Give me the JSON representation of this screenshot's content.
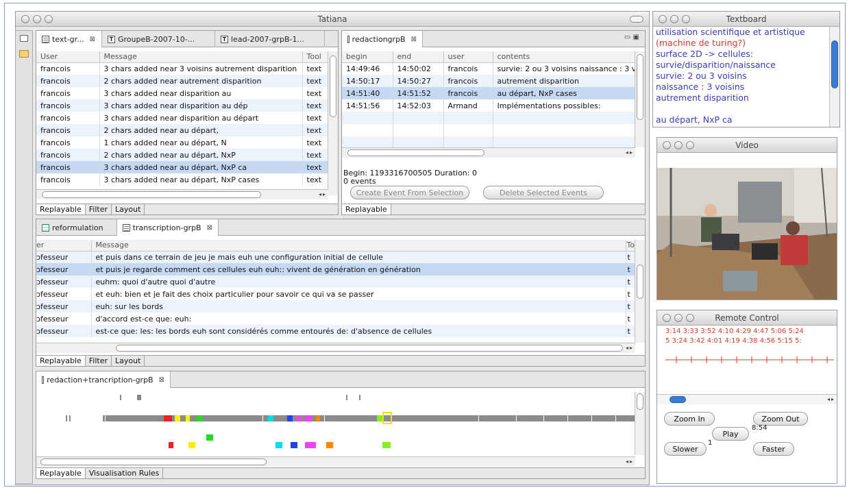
{
  "main_window": {
    "title": "Tatiana"
  },
  "text_panel": {
    "tabs": [
      {
        "label": "text-gr...",
        "closable": true
      },
      {
        "label": "GroupeB-2007-10-..."
      },
      {
        "label": "lead-2007-grpB-1..."
      }
    ],
    "columns": [
      "User",
      "Message",
      "Tool"
    ],
    "rows": [
      {
        "user": "francois",
        "message": "3 chars added near  3 voisins autrement disparition",
        "tool": "text"
      },
      {
        "user": "francois",
        "message": "2 chars added near  autrement disparition",
        "tool": "text"
      },
      {
        "user": "francois",
        "message": "3 chars added near  disparition  au",
        "tool": "text"
      },
      {
        "user": "francois",
        "message": "3 chars added near  disparition  au dép",
        "tool": "text"
      },
      {
        "user": "francois",
        "message": "3 chars added near  disparition  au départ",
        "tool": "text"
      },
      {
        "user": "francois",
        "message": "2 chars added near   au départ,",
        "tool": "text"
      },
      {
        "user": "francois",
        "message": "1 chars added near   au départ, N",
        "tool": "text"
      },
      {
        "user": "francois",
        "message": "2 chars added near   au départ, NxP",
        "tool": "text"
      },
      {
        "user": "francois",
        "message": "3 chars added near  au départ, NxP ca",
        "tool": "text"
      },
      {
        "user": "francois",
        "message": "3 chars added near  au départ, NxP cases",
        "tool": "text"
      }
    ],
    "bottom_tabs": [
      "Replayable",
      "Filter",
      "Layout"
    ]
  },
  "redaction_panel": {
    "tab": "redactiongrpB",
    "columns": [
      "begin",
      "end",
      "user",
      "contents"
    ],
    "rows": [
      {
        "begin": "14:49:46",
        "end": "14:50:02",
        "user": "francois",
        "contents": "survie: 2 ou 3 voisins naissance : 3 vo"
      },
      {
        "begin": "14:50:17",
        "end": "14:50:27",
        "user": "francois",
        "contents": "autrement disparition"
      },
      {
        "begin": "14:51:40",
        "end": "14:51:52",
        "user": "francois",
        "contents": "au départ, NxP cases"
      },
      {
        "begin": "14:51:56",
        "end": "14:52:03",
        "user": "Armand",
        "contents": "Implémentations possibles:"
      }
    ],
    "info_begin": "Begin: 1193316700505 Duration: 0",
    "info_events": "0 events",
    "create_button": "Create Event From Selection",
    "delete_button": "Delete Selected Events",
    "bottom_tab": "Replayable"
  },
  "transcription_panel": {
    "tabs": [
      {
        "label": "reformulation"
      },
      {
        "label": "transcription-grpB",
        "closable": true
      }
    ],
    "columns": [
      "er",
      "Message",
      "Too"
    ],
    "rows": [
      {
        "who": "ɔfesseur",
        "message": "et puis dans ce terrain de jeu je mais euh une configuration initial de cellule",
        "tool": "t"
      },
      {
        "who": "ɔfesseur",
        "message": "et puis je regarde comment ces cellules euh euh:: vivent de génération en génération",
        "tool": "t"
      },
      {
        "who": "ɔfesseur",
        "message": "euhm: quoi d'autre quoi d'autre",
        "tool": "t"
      },
      {
        "who": "ɔfesseur",
        "message": "et euh: bien et je fait des choix particulier pour savoir ce qui va se passer",
        "tool": "t"
      },
      {
        "who": "ɔfesseur",
        "message": "euh: sur les bords",
        "tool": "t"
      },
      {
        "who": "ɔfesseur",
        "message": "d'accord est-ce que: euh:",
        "tool": "t"
      },
      {
        "who": "ɔfesseur",
        "message": "est-ce que: les: les bords euh sont considérés comme entourés de: d'absence de cellules",
        "tool": "t"
      }
    ],
    "bottom_tabs": [
      "Replayable",
      "Filter",
      "Layout"
    ]
  },
  "timeline_panel": {
    "tab": "redaction+trancription-grpB",
    "bottom_tabs": [
      "Replayable",
      "Visualisation Rules"
    ],
    "colors": [
      "#ee2222",
      "#ffee00",
      "#22dd22",
      "#00ddee",
      "#2244ee",
      "#ee44ee",
      "#ff8800",
      "#88ee22",
      "#8a8a8a"
    ]
  },
  "textboard": {
    "title": "Textboard",
    "lines": [
      {
        "text": "utilisation scientifique et artistique",
        "color": "#3a3abd"
      },
      {
        "text": "(machine de turing?)",
        "color": "#d73a2a"
      },
      {
        "text": "surface 2D -> cellules:",
        "color": "#3a3abd"
      },
      {
        "text": "survie/disparition/naissance",
        "color": "#3a3abd"
      },
      {
        "text": "survie: 2 ou 3 voisins",
        "color": "#3a3abd"
      },
      {
        "text": "naissance : 3 voisins",
        "color": "#3a3abd"
      },
      {
        "text": "autrement disparition",
        "color": "#3a3abd"
      },
      {
        "text": "",
        "color": "#3a3abd"
      },
      {
        "text": "au départ, NxP ca",
        "color": "#3a3abd"
      }
    ]
  },
  "video": {
    "title": "Video"
  },
  "remote": {
    "title": "Remote Control",
    "ticks_row1": "3:14  3:33  3:52  4:10  4:29  4:47  5:06  5:24",
    "ticks_row2": "5  3:24  3:42  4:01  4:19  4:38  4:56  5:15  5:",
    "zoom_in": "Zoom In",
    "zoom_out": "Zoom Out",
    "play": "Play",
    "time": "8:54",
    "slower": "Slower",
    "speed": "1",
    "faster": "Faster"
  }
}
